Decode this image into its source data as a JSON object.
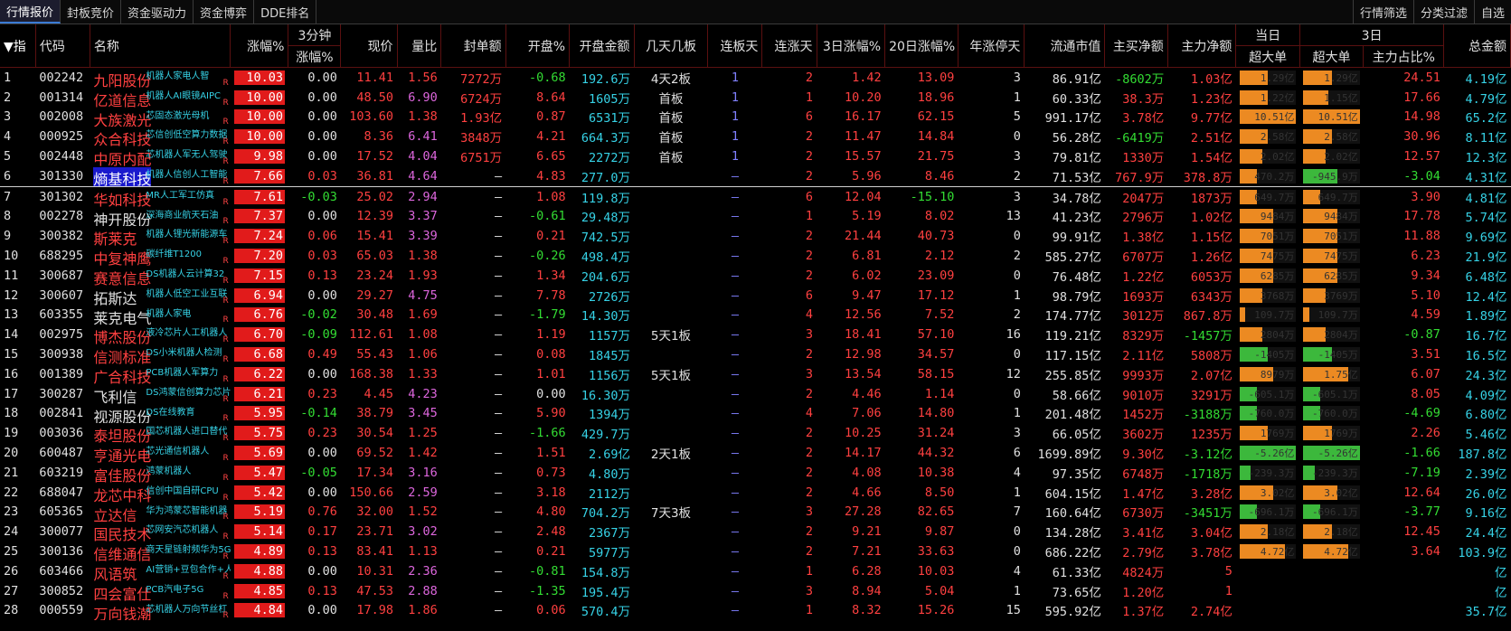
{
  "toolbar": {
    "left_tabs": [
      "行情报价",
      "封板竞价",
      "资金驱动力",
      "资金博弈",
      "DDE排名"
    ],
    "right_tabs": [
      "行情筛选",
      "分类过滤",
      "自选"
    ]
  },
  "header": {
    "row1": {
      "idx": "▼指",
      "code": "代码",
      "name": "名称",
      "pct": "涨幅%",
      "m3a": "3分钟",
      "price": "现价",
      "lb": "量比",
      "fdje": "封单额",
      "kp": "开盘%",
      "kpje": "开盘金额",
      "jtjb": "几天几板",
      "lbt": "连板天",
      "lzt": "连涨天",
      "d3": "3日涨幅%",
      "d20": "20日涨幅%",
      "nzt": "年涨停天",
      "ltsz": "流通市值",
      "zmjb": "主买净额",
      "zljb": "主力净额",
      "dr": "当日",
      "d3g": "3日",
      "zje": "总金额"
    },
    "row2": {
      "m3b": "涨幅%",
      "cdd1": "超大单",
      "cdd3": "超大单",
      "zlzb": "主力占比%"
    }
  },
  "rows": [
    {
      "idx": "1",
      "code": "002242",
      "name": "九阳股份",
      "name_color": "red",
      "concept": "机器人家电人智",
      "pct": "10.03",
      "m3": "0.00",
      "price": "11.41",
      "lb": "1.56",
      "fdje": "7272万",
      "kp": "-0.68",
      "kpje": "192.6万",
      "jtjb": "4天2板",
      "lbt": "1",
      "lzt": "2",
      "d3": "1.42",
      "d20": "13.09",
      "nzt": "3",
      "ltsz": "86.91亿",
      "zmjb": "-8602万",
      "zljb": "1.03亿",
      "cdd1": "1.29亿",
      "cdd1v": 0.5,
      "cdd3": "1.29亿",
      "cdd3v": 0.5,
      "zlzb": "24.51",
      "zje": "4.19亿"
    },
    {
      "idx": "2",
      "code": "001314",
      "name": "亿道信息",
      "name_color": "red",
      "concept": "机器人AI眼镜AIPC",
      "pct": "10.00",
      "m3": "0.00",
      "price": "48.50",
      "lb": "6.90",
      "fdje": "6724万",
      "kp": "8.64",
      "kpje": "1605万",
      "jtjb": "首板",
      "lbt": "1",
      "lzt": "1",
      "d3": "10.20",
      "d20": "18.96",
      "nzt": "1",
      "ltsz": "60.33亿",
      "zmjb": "38.3万",
      "zljb": "1.23亿",
      "cdd1": "1.22亿",
      "cdd1v": 0.5,
      "cdd3": "1.15亿",
      "cdd3v": 0.45,
      "zlzb": "17.66",
      "zje": "4.79亿"
    },
    {
      "idx": "3",
      "code": "002008",
      "name": "大族激光",
      "name_color": "red",
      "concept": "芯固态激光母机",
      "pct": "10.00",
      "m3": "0.00",
      "price": "103.60",
      "lb": "1.38",
      "fdje": "1.93亿",
      "kp": "0.87",
      "kpje": "6531万",
      "jtjb": "首板",
      "lbt": "1",
      "lzt": "6",
      "d3": "16.17",
      "d20": "62.15",
      "nzt": "5",
      "ltsz": "991.17亿",
      "zmjb": "3.78亿",
      "zljb": "9.77亿",
      "cdd1": "10.51亿",
      "cdd1v": 1.0,
      "cdd3": "10.51亿",
      "cdd3v": 1.0,
      "zlzb": "14.98",
      "zje": "65.2亿"
    },
    {
      "idx": "4",
      "code": "000925",
      "name": "众合科技",
      "name_color": "red",
      "concept": "芯信创低空算力数据",
      "pct": "10.00",
      "m3": "0.00",
      "price": "8.36",
      "lb": "6.41",
      "fdje": "3848万",
      "kp": "4.21",
      "kpje": "664.3万",
      "jtjb": "首板",
      "lbt": "1",
      "lzt": "2",
      "d3": "11.47",
      "d20": "14.84",
      "nzt": "0",
      "ltsz": "56.28亿",
      "zmjb": "-6419万",
      "zljb": "2.51亿",
      "cdd1": "2.58亿",
      "cdd1v": 0.5,
      "cdd3": "2.58亿",
      "cdd3v": 0.5,
      "zlzb": "30.96",
      "zje": "8.11亿"
    },
    {
      "idx": "5",
      "code": "002448",
      "name": "中原内配",
      "name_color": "red",
      "concept": "芯机器人军无人驾驶",
      "pct": "9.98",
      "m3": "0.00",
      "price": "17.52",
      "lb": "4.04",
      "fdje": "6751万",
      "kp": "6.65",
      "kpje": "2272万",
      "jtjb": "首板",
      "lbt": "1",
      "lzt": "2",
      "d3": "15.57",
      "d20": "21.75",
      "nzt": "3",
      "ltsz": "79.81亿",
      "zmjb": "1330万",
      "zljb": "1.54亿",
      "cdd1": "2.02亿",
      "cdd1v": 0.4,
      "cdd3": "2.02亿",
      "cdd3v": 0.4,
      "zlzb": "12.57",
      "zje": "12.3亿"
    },
    {
      "idx": "6",
      "code": "301330",
      "name": "熵基科技",
      "name_color": "hl",
      "concept": "机器人信创人工智能",
      "pct": "7.66",
      "m3": "0.03",
      "price": "36.81",
      "lb": "4.64",
      "fdje": "–",
      "kp": "4.83",
      "kpje": "277.0万",
      "jtjb": "",
      "lbt": "–",
      "lzt": "2",
      "d3": "5.96",
      "d20": "8.46",
      "nzt": "2",
      "ltsz": "71.53亿",
      "zmjb": "767.9万",
      "zljb": "378.8万",
      "cdd1": "470.2万",
      "cdd1v": 0.3,
      "cdd3": "-945.9万",
      "cdd3v": -0.6,
      "zlzb": "-3.04",
      "zje": "4.31亿"
    },
    {
      "idx": "7",
      "code": "301302",
      "name": "华如科技",
      "name_color": "red",
      "concept": "MR人工军工仿真",
      "pct": "7.61",
      "m3": "-0.03",
      "price": "25.02",
      "lb": "2.94",
      "fdje": "–",
      "kp": "1.08",
      "kpje": "119.8万",
      "jtjb": "",
      "lbt": "–",
      "lzt": "6",
      "d3": "12.04",
      "d20": "-15.10",
      "nzt": "3",
      "ltsz": "34.78亿",
      "zmjb": "2047万",
      "zljb": "1873万",
      "cdd1": "649.7万",
      "cdd1v": 0.3,
      "cdd3": "649.7万",
      "cdd3v": 0.3,
      "zlzb": "3.90",
      "zje": "4.81亿"
    },
    {
      "idx": "8",
      "code": "002278",
      "name": "神开股份",
      "name_color": "wht",
      "concept": "深海商业航天石油",
      "pct": "7.37",
      "m3": "0.00",
      "price": "12.39",
      "lb": "3.37",
      "fdje": "–",
      "kp": "-0.61",
      "kpje": "29.48万",
      "jtjb": "",
      "lbt": "–",
      "lzt": "1",
      "d3": "5.19",
      "d20": "8.02",
      "nzt": "13",
      "ltsz": "41.23亿",
      "zmjb": "2796万",
      "zljb": "1.02亿",
      "cdd1": "9484万",
      "cdd1v": 0.6,
      "cdd3": "9484万",
      "cdd3v": 0.6,
      "zlzb": "17.78",
      "zje": "5.74亿"
    },
    {
      "idx": "9",
      "code": "300382",
      "name": "斯莱克",
      "name_color": "red",
      "concept": "机器人锂光新能源车",
      "pct": "7.24",
      "m3": "0.06",
      "price": "15.41",
      "lb": "3.39",
      "fdje": "–",
      "kp": "0.21",
      "kpje": "742.5万",
      "jtjb": "",
      "lbt": "–",
      "lzt": "2",
      "d3": "21.44",
      "d20": "40.73",
      "nzt": "0",
      "ltsz": "99.91亿",
      "zmjb": "1.38亿",
      "zljb": "1.15亿",
      "cdd1": "7051万",
      "cdd1v": 0.6,
      "cdd3": "7051万",
      "cdd3v": 0.6,
      "zlzb": "11.88",
      "zje": "9.69亿"
    },
    {
      "idx": "10",
      "code": "688295",
      "name": "中复神鹰",
      "name_color": "red",
      "concept": "碳纤维T1200",
      "pct": "7.20",
      "m3": "0.03",
      "price": "65.03",
      "lb": "1.38",
      "fdje": "–",
      "kp": "-0.26",
      "kpje": "498.4万",
      "jtjb": "",
      "lbt": "–",
      "lzt": "2",
      "d3": "6.81",
      "d20": "2.12",
      "nzt": "2",
      "ltsz": "585.27亿",
      "zmjb": "6707万",
      "zljb": "1.26亿",
      "cdd1": "7475万",
      "cdd1v": 0.6,
      "cdd3": "7475万",
      "cdd3v": 0.6,
      "zlzb": "6.23",
      "zje": "21.9亿"
    },
    {
      "idx": "11",
      "code": "300687",
      "name": "赛意信息",
      "name_color": "red",
      "concept": "DS机器人云计算32",
      "pct": "7.15",
      "m3": "0.13",
      "price": "23.24",
      "lb": "1.93",
      "fdje": "–",
      "kp": "1.34",
      "kpje": "204.6万",
      "jtjb": "",
      "lbt": "–",
      "lzt": "2",
      "d3": "6.02",
      "d20": "23.09",
      "nzt": "0",
      "ltsz": "76.48亿",
      "zmjb": "1.22亿",
      "zljb": "6053万",
      "cdd1": "6285万",
      "cdd1v": 0.6,
      "cdd3": "6285万",
      "cdd3v": 0.6,
      "zlzb": "9.34",
      "zje": "6.48亿"
    },
    {
      "idx": "12",
      "code": "300607",
      "name": "拓斯达",
      "name_color": "wht",
      "concept": "机器人低空工业互联",
      "pct": "6.94",
      "m3": "0.00",
      "price": "29.27",
      "lb": "4.75",
      "fdje": "–",
      "kp": "7.78",
      "kpje": "2726万",
      "jtjb": "",
      "lbt": "–",
      "lzt": "6",
      "d3": "9.47",
      "d20": "17.12",
      "nzt": "1",
      "ltsz": "98.79亿",
      "zmjb": "1693万",
      "zljb": "6343万",
      "cdd1": "3768万",
      "cdd1v": 0.4,
      "cdd3": "3769万",
      "cdd3v": 0.4,
      "zlzb": "5.10",
      "zje": "12.4亿"
    },
    {
      "idx": "13",
      "code": "603355",
      "name": "莱克电气",
      "name_color": "wht",
      "concept": "机器人家电",
      "pct": "6.76",
      "m3": "-0.02",
      "price": "30.48",
      "lb": "1.69",
      "fdje": "–",
      "kp": "-1.79",
      "kpje": "14.30万",
      "jtjb": "",
      "lbt": "–",
      "lzt": "4",
      "d3": "12.56",
      "d20": "7.52",
      "nzt": "2",
      "ltsz": "174.77亿",
      "zmjb": "3012万",
      "zljb": "867.8万",
      "cdd1": "109.7万",
      "cdd1v": 0.1,
      "cdd3": "109.7万",
      "cdd3v": 0.1,
      "zlzb": "4.59",
      "zje": "1.89亿"
    },
    {
      "idx": "14",
      "code": "002975",
      "name": "博杰股份",
      "name_color": "red",
      "concept": "液冷芯片人工机器人",
      "pct": "6.70",
      "m3": "-0.09",
      "price": "112.61",
      "lb": "1.08",
      "fdje": "–",
      "kp": "1.19",
      "kpje": "1157万",
      "jtjb": "5天1板",
      "lbt": "–",
      "lzt": "3",
      "d3": "18.41",
      "d20": "57.10",
      "nzt": "16",
      "ltsz": "119.21亿",
      "zmjb": "8329万",
      "zljb": "-1457万",
      "cdd1": "2804万",
      "cdd1v": 0.4,
      "cdd3": "2804万",
      "cdd3v": 0.4,
      "zlzb": "-0.87",
      "zje": "16.7亿"
    },
    {
      "idx": "15",
      "code": "300938",
      "name": "信测标准",
      "name_color": "red",
      "concept": "DS小米机器人检测",
      "pct": "6.68",
      "m3": "0.49",
      "price": "55.43",
      "lb": "1.06",
      "fdje": "–",
      "kp": "0.08",
      "kpje": "1845万",
      "jtjb": "",
      "lbt": "–",
      "lzt": "2",
      "d3": "12.98",
      "d20": "34.57",
      "nzt": "0",
      "ltsz": "117.15亿",
      "zmjb": "2.11亿",
      "zljb": "5808万",
      "cdd1": "-1405万",
      "cdd1v": -0.5,
      "cdd3": "-1405万",
      "cdd3v": -0.5,
      "zlzb": "3.51",
      "zje": "16.5亿"
    },
    {
      "idx": "16",
      "code": "001389",
      "name": "广合科技",
      "name_color": "red",
      "concept": "PCB机器人军算力",
      "pct": "6.22",
      "m3": "0.00",
      "price": "168.38",
      "lb": "1.33",
      "fdje": "–",
      "kp": "1.01",
      "kpje": "1156万",
      "jtjb": "5天1板",
      "lbt": "–",
      "lzt": "3",
      "d3": "13.54",
      "d20": "58.15",
      "nzt": "12",
      "ltsz": "255.85亿",
      "zmjb": "9993万",
      "zljb": "2.07亿",
      "cdd1": "8979万",
      "cdd1v": 0.6,
      "cdd3": "1.75亿",
      "cdd3v": 0.8,
      "zlzb": "6.07",
      "zje": "24.3亿"
    },
    {
      "idx": "17",
      "code": "300287",
      "name": "飞利信",
      "name_color": "wht",
      "concept": "DS鸿蒙信创算力芯片",
      "pct": "6.21",
      "m3": "0.23",
      "price": "4.45",
      "lb": "4.23",
      "fdje": "–",
      "kp": "0.00",
      "kpje": "16.30万",
      "jtjb": "",
      "lbt": "–",
      "lzt": "2",
      "d3": "4.46",
      "d20": "1.14",
      "nzt": "0",
      "ltsz": "58.66亿",
      "zmjb": "9010万",
      "zljb": "3291万",
      "cdd1": "-605.1万",
      "cdd1v": -0.3,
      "cdd3": "-605.1万",
      "cdd3v": -0.3,
      "zlzb": "8.05",
      "zje": "4.09亿"
    },
    {
      "idx": "18",
      "code": "002841",
      "name": "视源股份",
      "name_color": "wht",
      "concept": "DS在线教育",
      "pct": "5.95",
      "m3": "-0.14",
      "price": "38.79",
      "lb": "3.45",
      "fdje": "–",
      "kp": "5.90",
      "kpje": "1394万",
      "jtjb": "",
      "lbt": "–",
      "lzt": "4",
      "d3": "7.06",
      "d20": "14.80",
      "nzt": "1",
      "ltsz": "201.48亿",
      "zmjb": "1452万",
      "zljb": "-3188万",
      "cdd1": "-760.0万",
      "cdd1v": -0.3,
      "cdd3": "-760.0万",
      "cdd3v": -0.3,
      "zlzb": "-4.69",
      "zje": "6.80亿"
    },
    {
      "idx": "19",
      "code": "003036",
      "name": "泰坦股份",
      "name_color": "red",
      "concept": "国芯机器人进口替代",
      "pct": "5.75",
      "m3": "0.23",
      "price": "30.54",
      "lb": "1.25",
      "fdje": "–",
      "kp": "-1.66",
      "kpje": "429.7万",
      "jtjb": "",
      "lbt": "–",
      "lzt": "2",
      "d3": "10.25",
      "d20": "31.24",
      "nzt": "3",
      "ltsz": "66.05亿",
      "zmjb": "3602万",
      "zljb": "1235万",
      "cdd1": "1769万",
      "cdd1v": 0.5,
      "cdd3": "1769万",
      "cdd3v": 0.5,
      "zlzb": "2.26",
      "zje": "5.46亿"
    },
    {
      "idx": "20",
      "code": "600487",
      "name": "亨通光电",
      "name_color": "red",
      "concept": "芯光通信机器人",
      "pct": "5.69",
      "m3": "0.00",
      "price": "69.52",
      "lb": "1.42",
      "fdje": "–",
      "kp": "1.51",
      "kpje": "2.69亿",
      "jtjb": "2天1板",
      "lbt": "–",
      "lzt": "2",
      "d3": "14.17",
      "d20": "44.32",
      "nzt": "6",
      "ltsz": "1699.89亿",
      "zmjb": "9.30亿",
      "zljb": "-3.12亿",
      "cdd1": "-5.26亿",
      "cdd1v": -1.0,
      "cdd3": "-5.26亿",
      "cdd3v": -1.0,
      "zlzb": "-1.66",
      "zje": "187.8亿"
    },
    {
      "idx": "21",
      "code": "603219",
      "name": "富佳股份",
      "name_color": "red",
      "concept": "鸿蒙机器人",
      "pct": "5.47",
      "m3": "-0.05",
      "price": "17.34",
      "lb": "3.16",
      "fdje": "–",
      "kp": "0.73",
      "kpje": "4.80万",
      "jtjb": "",
      "lbt": "–",
      "lzt": "2",
      "d3": "4.08",
      "d20": "10.38",
      "nzt": "4",
      "ltsz": "97.35亿",
      "zmjb": "6748万",
      "zljb": "-1718万",
      "cdd1": "-239.3万",
      "cdd1v": -0.2,
      "cdd3": "-239.3万",
      "cdd3v": -0.2,
      "zlzb": "-7.19",
      "zje": "2.39亿"
    },
    {
      "idx": "22",
      "code": "688047",
      "name": "龙芯中科",
      "name_color": "red",
      "concept": "信创中国自研CPU",
      "pct": "5.42",
      "m3": "0.00",
      "price": "150.66",
      "lb": "2.59",
      "fdje": "–",
      "kp": "3.18",
      "kpje": "2112万",
      "jtjb": "",
      "lbt": "–",
      "lzt": "2",
      "d3": "4.66",
      "d20": "8.50",
      "nzt": "1",
      "ltsz": "604.15亿",
      "zmjb": "1.47亿",
      "zljb": "3.28亿",
      "cdd1": "3.02亿",
      "cdd1v": 0.6,
      "cdd3": "3.02亿",
      "cdd3v": 0.6,
      "zlzb": "12.64",
      "zje": "26.0亿"
    },
    {
      "idx": "23",
      "code": "605365",
      "name": "立达信",
      "name_color": "red",
      "concept": "华为鸿蒙芯智能机器",
      "pct": "5.19",
      "m3": "0.76",
      "price": "32.00",
      "lb": "1.52",
      "fdje": "–",
      "kp": "4.80",
      "kpje": "704.2万",
      "jtjb": "7天3板",
      "lbt": "–",
      "lzt": "3",
      "d3": "27.28",
      "d20": "82.65",
      "nzt": "7",
      "ltsz": "160.64亿",
      "zmjb": "6730万",
      "zljb": "-3451万",
      "cdd1": "-696.1万",
      "cdd1v": -0.3,
      "cdd3": "-696.1万",
      "cdd3v": -0.3,
      "zlzb": "-3.77",
      "zje": "9.16亿"
    },
    {
      "idx": "24",
      "code": "300077",
      "name": "国民技术",
      "name_color": "red",
      "concept": "芯网安汽芯机器人",
      "pct": "5.14",
      "m3": "0.17",
      "price": "23.71",
      "lb": "3.02",
      "fdje": "–",
      "kp": "2.48",
      "kpje": "2367万",
      "jtjb": "",
      "lbt": "–",
      "lzt": "2",
      "d3": "9.21",
      "d20": "9.87",
      "nzt": "0",
      "ltsz": "134.28亿",
      "zmjb": "3.41亿",
      "zljb": "3.04亿",
      "cdd1": "2.18亿",
      "cdd1v": 0.5,
      "cdd3": "2.18亿",
      "cdd3v": 0.5,
      "zlzb": "12.45",
      "zje": "24.4亿"
    },
    {
      "idx": "25",
      "code": "300136",
      "name": "信维通信",
      "name_color": "red",
      "concept": "商天星链射频华为5G天",
      "pct": "4.89",
      "m3": "0.13",
      "price": "83.41",
      "lb": "1.13",
      "fdje": "–",
      "kp": "0.21",
      "kpje": "5977万",
      "jtjb": "",
      "lbt": "–",
      "lzt": "2",
      "d3": "7.21",
      "d20": "33.63",
      "nzt": "0",
      "ltsz": "686.22亿",
      "zmjb": "2.79亿",
      "zljb": "3.78亿",
      "cdd1": "4.72亿",
      "cdd1v": 0.8,
      "cdd3": "4.72亿",
      "cdd3v": 0.8,
      "zlzb": "3.64",
      "zje": "103.9亿"
    },
    {
      "idx": "26",
      "code": "603466",
      "name": "风语筑",
      "name_color": "red",
      "concept": "AI营销+豆包合作+人形",
      "pct": "4.88",
      "m3": "0.00",
      "price": "10.31",
      "lb": "2.36",
      "fdje": "–",
      "kp": "-0.81",
      "kpje": "154.8万",
      "jtjb": "",
      "lbt": "–",
      "lzt": "1",
      "d3": "6.28",
      "d20": "10.03",
      "nzt": "4",
      "ltsz": "61.33亿",
      "zmjb": "4824万",
      "zljb": "5",
      "cdd1": "",
      "cdd1v": 0,
      "cdd3": "",
      "cdd3v": 0,
      "zlzb": "",
      "zje": "亿"
    },
    {
      "idx": "27",
      "code": "300852",
      "name": "四会富仕",
      "name_color": "red",
      "concept": "PCB汽电子5G",
      "pct": "4.85",
      "m3": "0.13",
      "price": "47.53",
      "lb": "2.88",
      "fdje": "–",
      "kp": "-1.35",
      "kpje": "195.4万",
      "jtjb": "",
      "lbt": "–",
      "lzt": "3",
      "d3": "8.94",
      "d20": "5.04",
      "nzt": "1",
      "ltsz": "73.65亿",
      "zmjb": "1.20亿",
      "zljb": "1",
      "cdd1": "",
      "cdd1v": 0,
      "cdd3": "",
      "cdd3v": 0,
      "zlzb": "",
      "zje": "亿"
    },
    {
      "idx": "28",
      "code": "000559",
      "name": "万向钱潮",
      "name_color": "red",
      "concept": "芯机器人万向节丝杠",
      "pct": "4.84",
      "m3": "0.00",
      "price": "17.98",
      "lb": "1.86",
      "fdje": "–",
      "kp": "0.06",
      "kpje": "570.4万",
      "jtjb": "",
      "lbt": "–",
      "lzt": "1",
      "d3": "8.32",
      "d20": "15.26",
      "nzt": "15",
      "ltsz": "595.92亿",
      "zmjb": "1.37亿",
      "zljb": "2.74亿",
      "cdd1": "",
      "cdd1v": 0,
      "cdd3": "",
      "cdd3v": 0,
      "zlzb": "",
      "zje": "35.7亿"
    }
  ]
}
